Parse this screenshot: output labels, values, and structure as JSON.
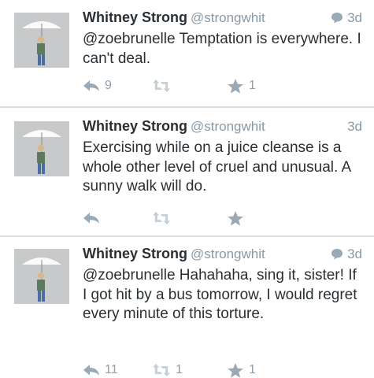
{
  "colors": {
    "name": "#292f33",
    "muted": "#8899a6",
    "action_icon": "#99a9b5",
    "divider": "#d9dde0"
  },
  "tweets": [
    {
      "name": "Whitney Strong",
      "handle": "@strongwhit",
      "time": "3d",
      "has_reply_indicator": true,
      "text": "@zoebrunelle Temptation is everywhere. I can't deal.",
      "reply_count": "9",
      "retweet_count": "",
      "favorite_count": "1",
      "icons": [
        "reply-icon",
        "retweet-icon",
        "star-icon"
      ]
    },
    {
      "name": "Whitney Strong",
      "handle": "@strongwhit",
      "time": "3d",
      "has_reply_indicator": false,
      "text": "Exercising while on a juice cleanse is a whole other level of cruel and unusual. A sunny walk will do.",
      "reply_count": "",
      "retweet_count": "",
      "favorite_count": "",
      "icons": [
        "reply-icon",
        "retweet-icon",
        "star-icon"
      ]
    },
    {
      "name": "Whitney Strong",
      "handle": "@strongwhit",
      "time": "3d",
      "has_reply_indicator": true,
      "text": "@zoebrunelle Hahahaha, sing it, sister! If I got hit by a bus tomorrow, I would regret every minute of this torture.",
      "reply_count": "11",
      "retweet_count": "1",
      "favorite_count": "1",
      "icons": [
        "reply-icon",
        "retweet-icon",
        "star-icon"
      ]
    }
  ]
}
